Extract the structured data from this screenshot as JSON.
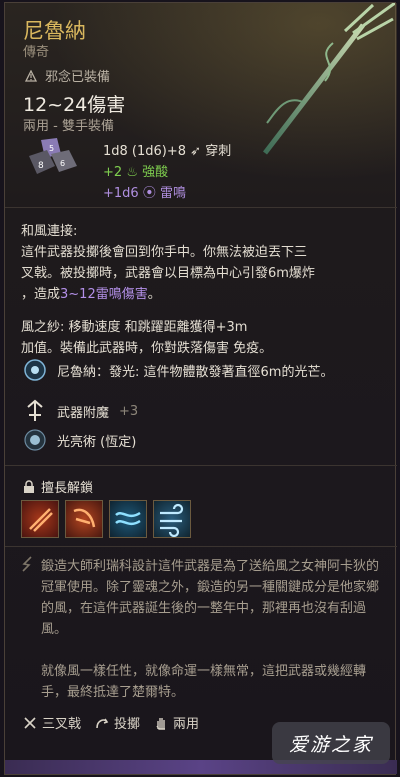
{
  "item": {
    "name": "尼魯納",
    "rarity": "傳奇",
    "cursed_label": "邪念已裝備",
    "damage": "12~24傷害",
    "handedness": "兩用 - 雙手裝備",
    "damage_lines": {
      "base": "1d8 (1d6)+8",
      "base_type": "穿刺",
      "bonus": "+2",
      "bonus_type": "強酸",
      "extra": "+1d6",
      "extra_type": "雷鳴"
    }
  },
  "passive": {
    "title": "和風連接:",
    "line1": "這件武器投擲後會回到你手中。你無法被迫丟下三",
    "line2": "叉戟。被投擲時，武器會以目標為中心引發6m爆炸",
    "line3_prefix": "，造成",
    "line3_highlight": "3~12雷鳴傷害",
    "line3_suffix": "。",
    "wind_line1": "風之紗: 移動速度 和跳躍距離獲得+3m",
    "wind_line2": "加值。裝備此武器時，你對跌落傷害 免疫。"
  },
  "abilities": [
    {
      "label": "尼魯納：發光: 這件物體散發著直徑6m的光芒。"
    },
    {
      "label": "武器附魔",
      "suffix": "+3"
    },
    {
      "label": "光亮術 (恆定)"
    }
  ],
  "unlock": {
    "title": "擅長解鎖"
  },
  "lore": {
    "p1": "鍛造大師利瑞科設計這件武器是為了送給風之女神阿卡狄的冠軍使用。除了靈魂之外，鍛造的另一種關鍵成分是他家鄉的風，在這件武器誕生後的一整年中，那裡再也沒有刮過風。",
    "p2": "就像風一樣任性，就像命運一樣無常，這把武器或幾經轉手，最終抵達了楚爾特。"
  },
  "footer": {
    "type": "三叉戟",
    "throw": "投擲",
    "versatile": "兩用"
  },
  "watermark": "爱游之家",
  "colors": {
    "title": "#d9b75e",
    "acid": "#7fcf4f",
    "thunder": "#b08fe0",
    "rarity_bar": "#5a4386"
  }
}
